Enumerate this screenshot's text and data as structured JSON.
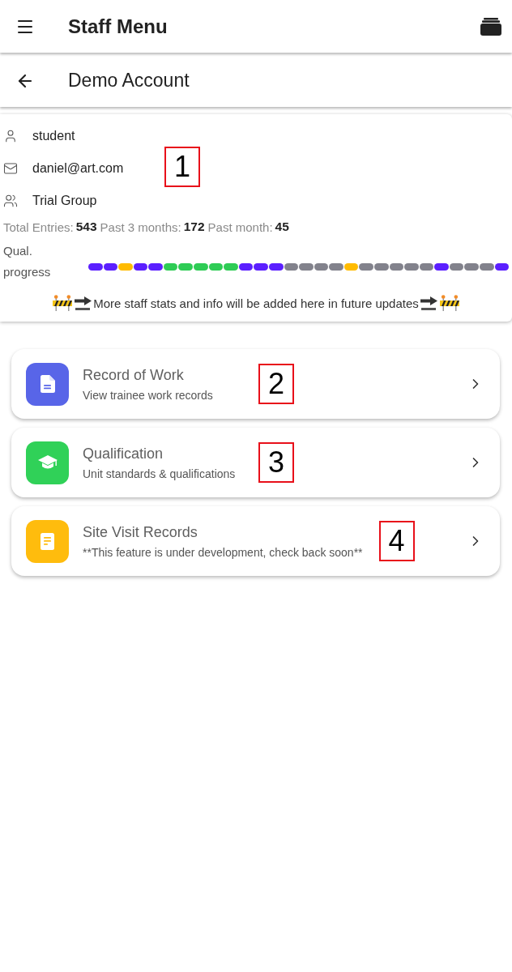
{
  "app_bar": {
    "title": "Staff Menu"
  },
  "sub_bar": {
    "title": "Demo Account"
  },
  "profile": {
    "marker": "1",
    "details": [
      {
        "kind": "user",
        "text": "student"
      },
      {
        "kind": "email",
        "text": "daniel@art.com"
      },
      {
        "kind": "group",
        "text": "Trial Group"
      }
    ],
    "stats": [
      {
        "label": "Total Entries:",
        "value": "543"
      },
      {
        "label": "Past 3 months:",
        "value": "172"
      },
      {
        "label": "Past month:",
        "value": "45"
      }
    ],
    "progress": {
      "label": "Qual. progress",
      "segments": [
        {
          "color": "#5b1fff"
        },
        {
          "color": "#5b1fff"
        },
        {
          "color": "#ffbb00"
        },
        {
          "color": "#5b1fff"
        },
        {
          "color": "#5b1fff"
        },
        {
          "color": "#2ecc55"
        },
        {
          "color": "#2ecc55"
        },
        {
          "color": "#2ecc55"
        },
        {
          "color": "#2ecc55"
        },
        {
          "color": "#2ecc55"
        },
        {
          "color": "#5b1fff"
        },
        {
          "color": "#5b1fff"
        },
        {
          "color": "#5b1fff"
        },
        {
          "color": "#82828c"
        },
        {
          "color": "#82828c"
        },
        {
          "color": "#82828c"
        },
        {
          "color": "#82828c"
        },
        {
          "color": "#ffbb00"
        },
        {
          "color": "#82828c"
        },
        {
          "color": "#82828c"
        },
        {
          "color": "#82828c"
        },
        {
          "color": "#82828c"
        },
        {
          "color": "#82828c"
        },
        {
          "color": "#5b1fff"
        },
        {
          "color": "#82828c"
        },
        {
          "color": "#82828c"
        },
        {
          "color": "#82828c"
        },
        {
          "color": "#5b1fff"
        }
      ]
    },
    "notice": "More staff stats and info will be added here in future updates"
  },
  "menu": [
    {
      "kind": "document",
      "color": "#5865e8",
      "title": "Record of Work",
      "subtitle": "View trainee work records",
      "marker": "2"
    },
    {
      "kind": "graduation",
      "color": "#30d158",
      "title": "Qualification",
      "subtitle": "Unit standards & qualifications",
      "marker": "3"
    },
    {
      "kind": "note",
      "color": "#ffbc0d",
      "title": "Site Visit Records",
      "subtitle": "**This feature is under development, check back soon**",
      "marker": "4"
    }
  ]
}
